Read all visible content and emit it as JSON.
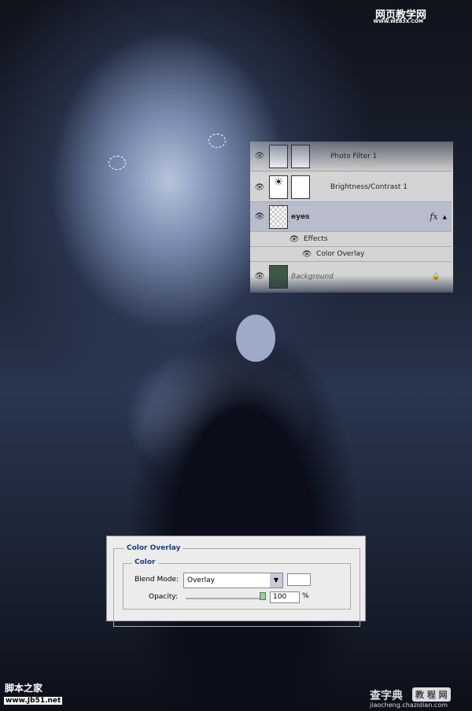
{
  "layers_panel": {
    "layers": [
      {
        "name": "Photo Filter 1",
        "visible": true,
        "icon": "photo-filter-icon"
      },
      {
        "name": "Brightness/Contrast 1",
        "visible": true,
        "icon": "brightness-icon"
      },
      {
        "name": "eyes",
        "visible": true,
        "selected": true,
        "fx": "fx"
      },
      {
        "name": "Background",
        "visible": true,
        "locked": true
      }
    ],
    "effects_label": "Effects",
    "effect_item": "Color Overlay"
  },
  "dialog": {
    "title": "Color Overlay",
    "group": "Color",
    "blend_mode_label": "Blend Mode:",
    "blend_mode_value": "Overlay",
    "opacity_label": "Opacity:",
    "opacity_value": "100",
    "opacity_unit": "%",
    "overlay_color": "#ffffff",
    "title_color": "#1c3f7a"
  },
  "watermarks": {
    "top_cn": "网页教学网",
    "top_url": "WWW.WEB3X.COM",
    "bl_cn": "脚本之家",
    "bl_url": "www.Jb51.net",
    "br_cn1": "查字典",
    "br_cn2": "教 程 网",
    "br_url": "jiaocheng.chazidian.com"
  }
}
